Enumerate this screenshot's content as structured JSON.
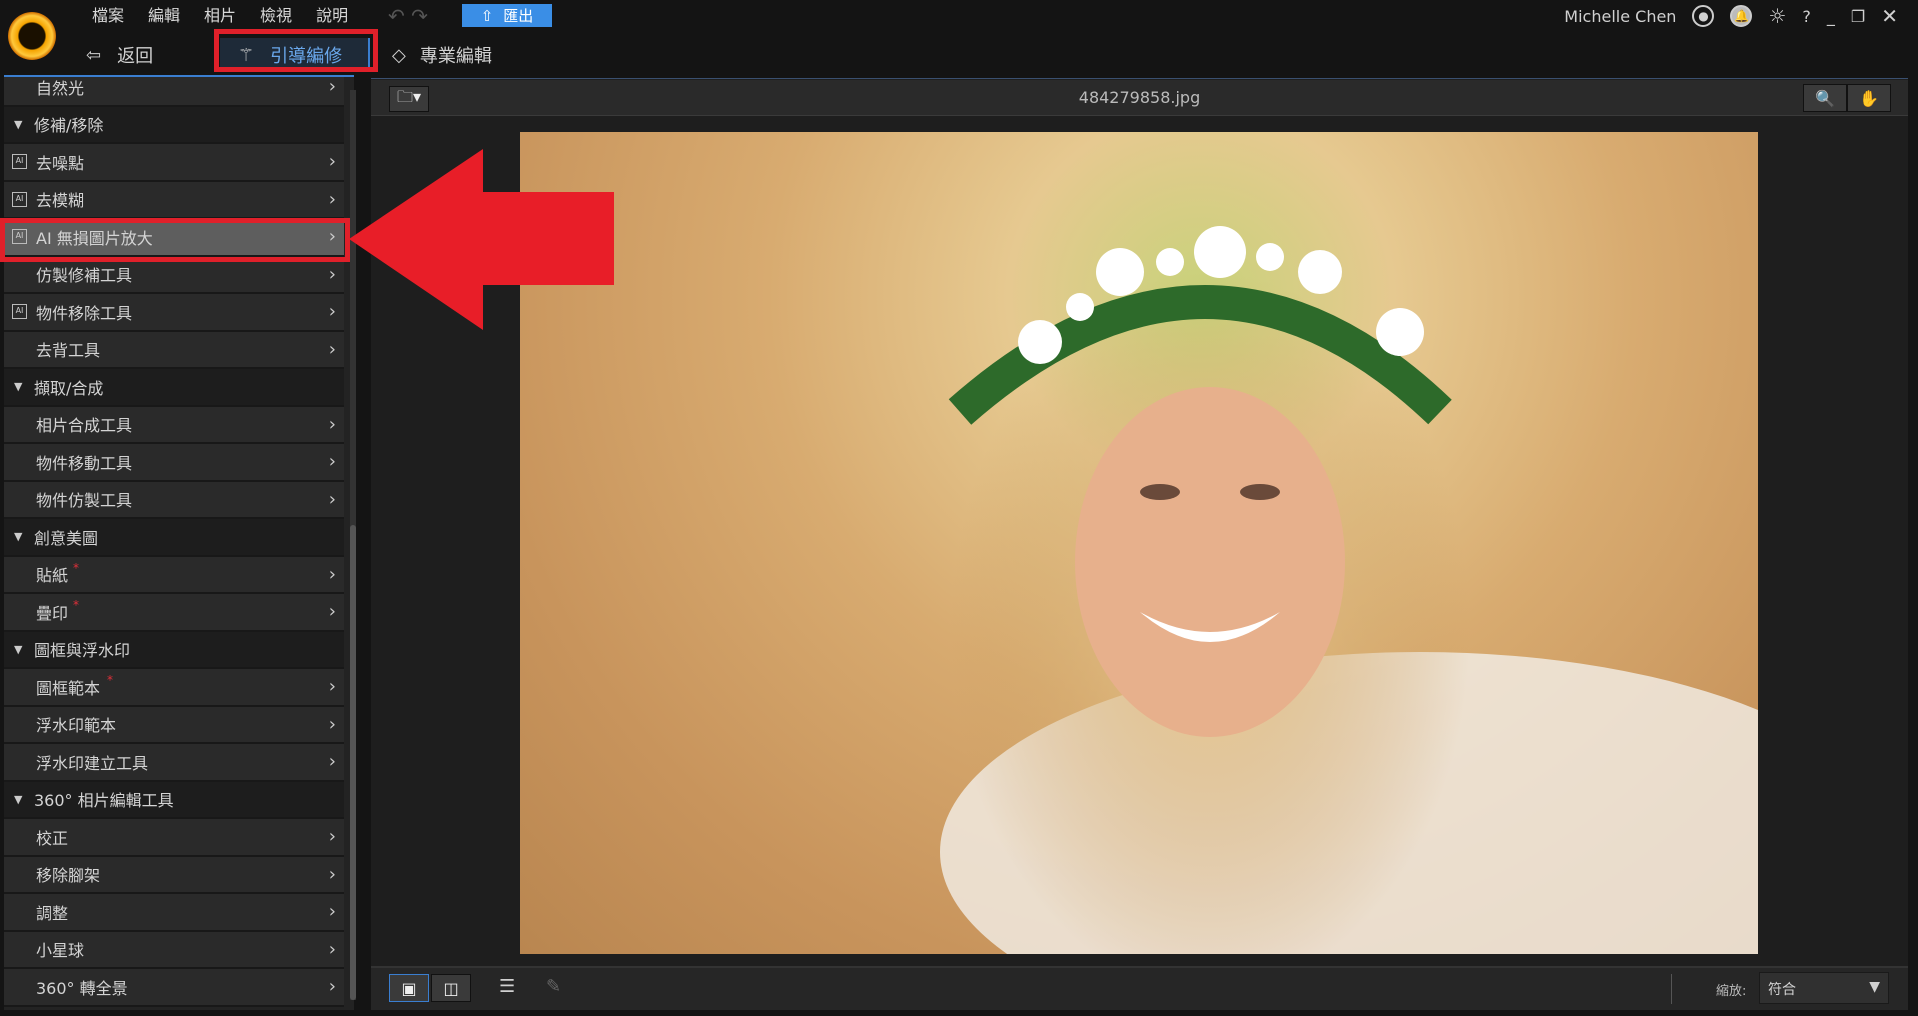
{
  "menu": {
    "items": [
      "檔案",
      "編輯",
      "相片",
      "檢視",
      "說明"
    ],
    "export": "匯出"
  },
  "user": {
    "name": "Michelle Chen"
  },
  "toolbar": {
    "back": "返回",
    "guided": "引導編修",
    "pro": "專業編輯"
  },
  "panel": {
    "rows": [
      {
        "label": "自然光",
        "type": "item"
      },
      {
        "label": "修補/移除",
        "type": "section"
      },
      {
        "label": "去噪點",
        "type": "item",
        "ai": true
      },
      {
        "label": "去模糊",
        "type": "item",
        "ai": true
      },
      {
        "label": "AI 無損圖片放大",
        "type": "item",
        "ai": true,
        "selected": true
      },
      {
        "label": "仿製修補工具",
        "type": "item"
      },
      {
        "label": "物件移除工具",
        "type": "item",
        "ai": true
      },
      {
        "label": "去背工具",
        "type": "item"
      },
      {
        "label": "擷取/合成",
        "type": "section"
      },
      {
        "label": "相片合成工具",
        "type": "item"
      },
      {
        "label": "物件移動工具",
        "type": "item"
      },
      {
        "label": "物件仿製工具",
        "type": "item"
      },
      {
        "label": "創意美圖",
        "type": "section"
      },
      {
        "label": "貼紙",
        "type": "item",
        "new": true
      },
      {
        "label": "疊印",
        "type": "item",
        "new": true
      },
      {
        "label": "圖框與浮水印",
        "type": "section"
      },
      {
        "label": "圖框範本",
        "type": "item",
        "new": true
      },
      {
        "label": "浮水印範本",
        "type": "item"
      },
      {
        "label": "浮水印建立工具",
        "type": "item"
      },
      {
        "label": "360° 相片編輯工具",
        "type": "section"
      },
      {
        "label": "校正",
        "type": "item"
      },
      {
        "label": "移除腳架",
        "type": "item"
      },
      {
        "label": "調整",
        "type": "item"
      },
      {
        "label": "小星球",
        "type": "item"
      },
      {
        "label": "360° 轉全景",
        "type": "item"
      }
    ]
  },
  "canvas": {
    "filename": "484279858.jpg",
    "zoom_label": "縮放:",
    "zoom_value": "符合"
  },
  "colors": {
    "accent": "#3a8ee6",
    "highlight": "#e0202a"
  }
}
